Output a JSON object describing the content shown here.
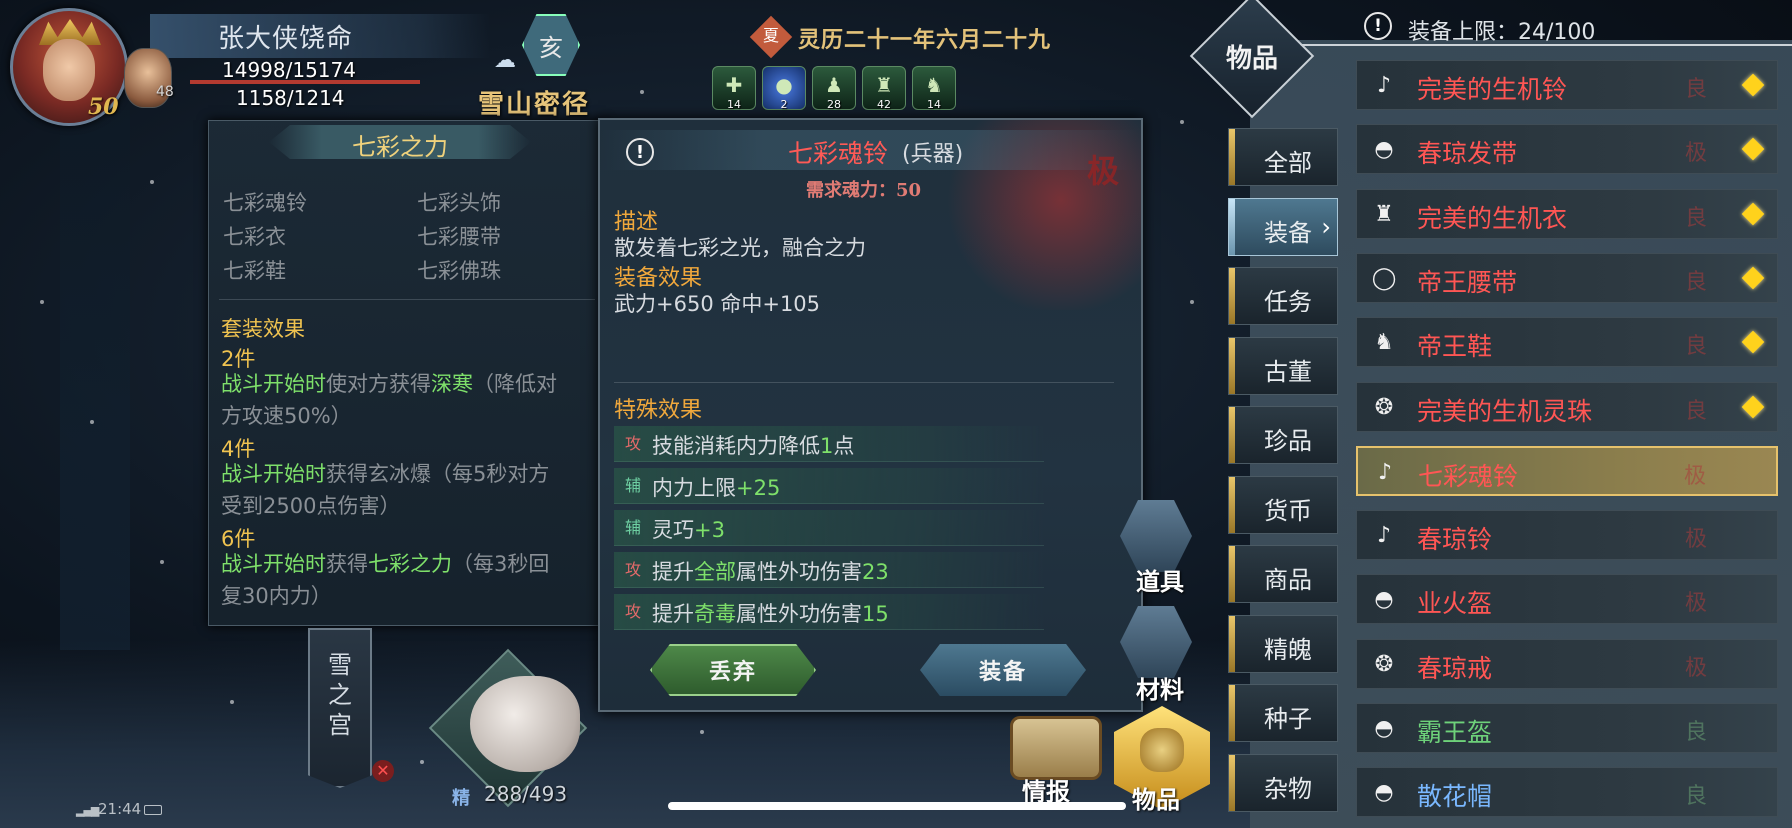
{
  "hud": {
    "player_name": "张大侠饶命",
    "player_level": "50",
    "hp": "14998/15174",
    "mp": "1158/1214",
    "companion_level": "48",
    "time_badge": "亥",
    "location": "雪山密径",
    "date_badge": "夏",
    "date": "灵历二十一年六月二十九",
    "status_icons": [
      {
        "icon": "shield-cross-icon",
        "count": "14"
      },
      {
        "icon": "blue-orb-icon",
        "count": "2"
      },
      {
        "icon": "soldier-icon",
        "count": "28"
      },
      {
        "icon": "warrior-icon",
        "count": "42"
      },
      {
        "icon": "guard-icon",
        "count": "14"
      }
    ]
  },
  "set_panel": {
    "title": "七彩之力",
    "pieces": [
      "七彩魂铃",
      "七彩头饰",
      "七彩衣",
      "七彩腰带",
      "七彩鞋",
      "七彩佛珠"
    ],
    "set_effect_label": "套装效果",
    "tiers": [
      {
        "count": "2件",
        "trigger": "战斗开始时",
        "pre": "使对方获得",
        "keyword": "深寒",
        "line1_rest": "（降低对",
        "line2": "方攻速50%）"
      },
      {
        "count": "4件",
        "trigger": "战斗开始时",
        "pre": "获得玄冰爆（每5秒对方",
        "line2": "受到2500点伤害）"
      },
      {
        "count": "6件",
        "trigger": "战斗开始时",
        "pre": "获得",
        "keyword": "七彩之力",
        "line1_rest": "（每3秒回",
        "line2": "复30内力）"
      }
    ]
  },
  "item_panel": {
    "name": "七彩魂铃",
    "type": "(兵器)",
    "grade_stamp": "极",
    "requirement": "需求魂力：50",
    "desc_label": "描述",
    "description": "散发着七彩之光，融合之力",
    "equip_label": "装备效果",
    "equip_stats": "武力+650  命中+105",
    "special_label": "特殊效果",
    "effects": [
      {
        "tag": "攻",
        "kind": "atk",
        "pre": "技能消耗内力降低",
        "num": "1",
        "post": "点"
      },
      {
        "tag": "辅",
        "kind": "sup",
        "pre": "内力上限",
        "num": "+25",
        "post": ""
      },
      {
        "tag": "辅",
        "kind": "sup",
        "pre": "灵巧",
        "num": "+3",
        "post": ""
      },
      {
        "tag": "攻",
        "kind": "atk",
        "pre": "提升",
        "kw": "全部",
        "mid": "属性外功伤害",
        "num": "23"
      },
      {
        "tag": "攻",
        "kind": "atk",
        "pre": "提升",
        "kw": "奇毒",
        "mid": "属性外功伤害",
        "num": "15"
      }
    ],
    "drop_label": "丢弃",
    "equip_button_label": "装备"
  },
  "bottom": {
    "palace_label": "雪之宫",
    "pet_stat_label": "精",
    "pet_stat": "288/493",
    "clock": "21:44",
    "quick": {
      "props": "道具",
      "materials": "材料",
      "intel": "情报",
      "items": "物品"
    }
  },
  "inventory": {
    "tab_title": "物品",
    "capacity": "装备上限：24/100",
    "categories": [
      "全部",
      "装备",
      "任务",
      "古董",
      "珍品",
      "货币",
      "商品",
      "精魄",
      "种子",
      "杂物"
    ],
    "active_category": "装备",
    "items": [
      {
        "icon": "bell-icon",
        "glyph": "♪",
        "name": "完美的生机铃",
        "grade": "良",
        "color": "red",
        "new": true
      },
      {
        "icon": "headband-icon",
        "glyph": "◓",
        "name": "春琼发带",
        "grade": "极",
        "color": "red",
        "new": true
      },
      {
        "icon": "robe-icon",
        "glyph": "♜",
        "name": "完美的生机衣",
        "grade": "良",
        "color": "red",
        "new": true
      },
      {
        "icon": "belt-icon",
        "glyph": "◯",
        "name": "帝王腰带",
        "grade": "良",
        "color": "red",
        "new": true
      },
      {
        "icon": "boots-icon",
        "glyph": "♞",
        "name": "帝王鞋",
        "grade": "良",
        "color": "red",
        "new": true
      },
      {
        "icon": "bead-icon",
        "glyph": "❂",
        "name": "完美的生机灵珠",
        "grade": "良",
        "color": "red",
        "new": true
      },
      {
        "icon": "bell-icon",
        "glyph": "♪",
        "name": "七彩魂铃",
        "grade": "极",
        "color": "red",
        "new": false,
        "selected": true
      },
      {
        "icon": "bell-icon",
        "glyph": "♪",
        "name": "春琼铃",
        "grade": "极",
        "color": "red",
        "new": false
      },
      {
        "icon": "helmet-icon",
        "glyph": "◓",
        "name": "业火盔",
        "grade": "极",
        "color": "red",
        "new": false
      },
      {
        "icon": "ring-icon",
        "glyph": "❂",
        "name": "春琼戒",
        "grade": "极",
        "color": "red",
        "new": false
      },
      {
        "icon": "helmet-icon",
        "glyph": "◓",
        "name": "霸王盔",
        "grade": "良",
        "color": "green",
        "new": false
      },
      {
        "icon": "hat-icon",
        "glyph": "◓",
        "name": "散花帽",
        "grade": "良",
        "color": "blue",
        "new": false
      }
    ]
  },
  "colors": {
    "item_red": "#ff5654",
    "accent_gold": "#f0c350",
    "effect_green": "#7ee06a",
    "new_marker": "#ffd21c"
  }
}
